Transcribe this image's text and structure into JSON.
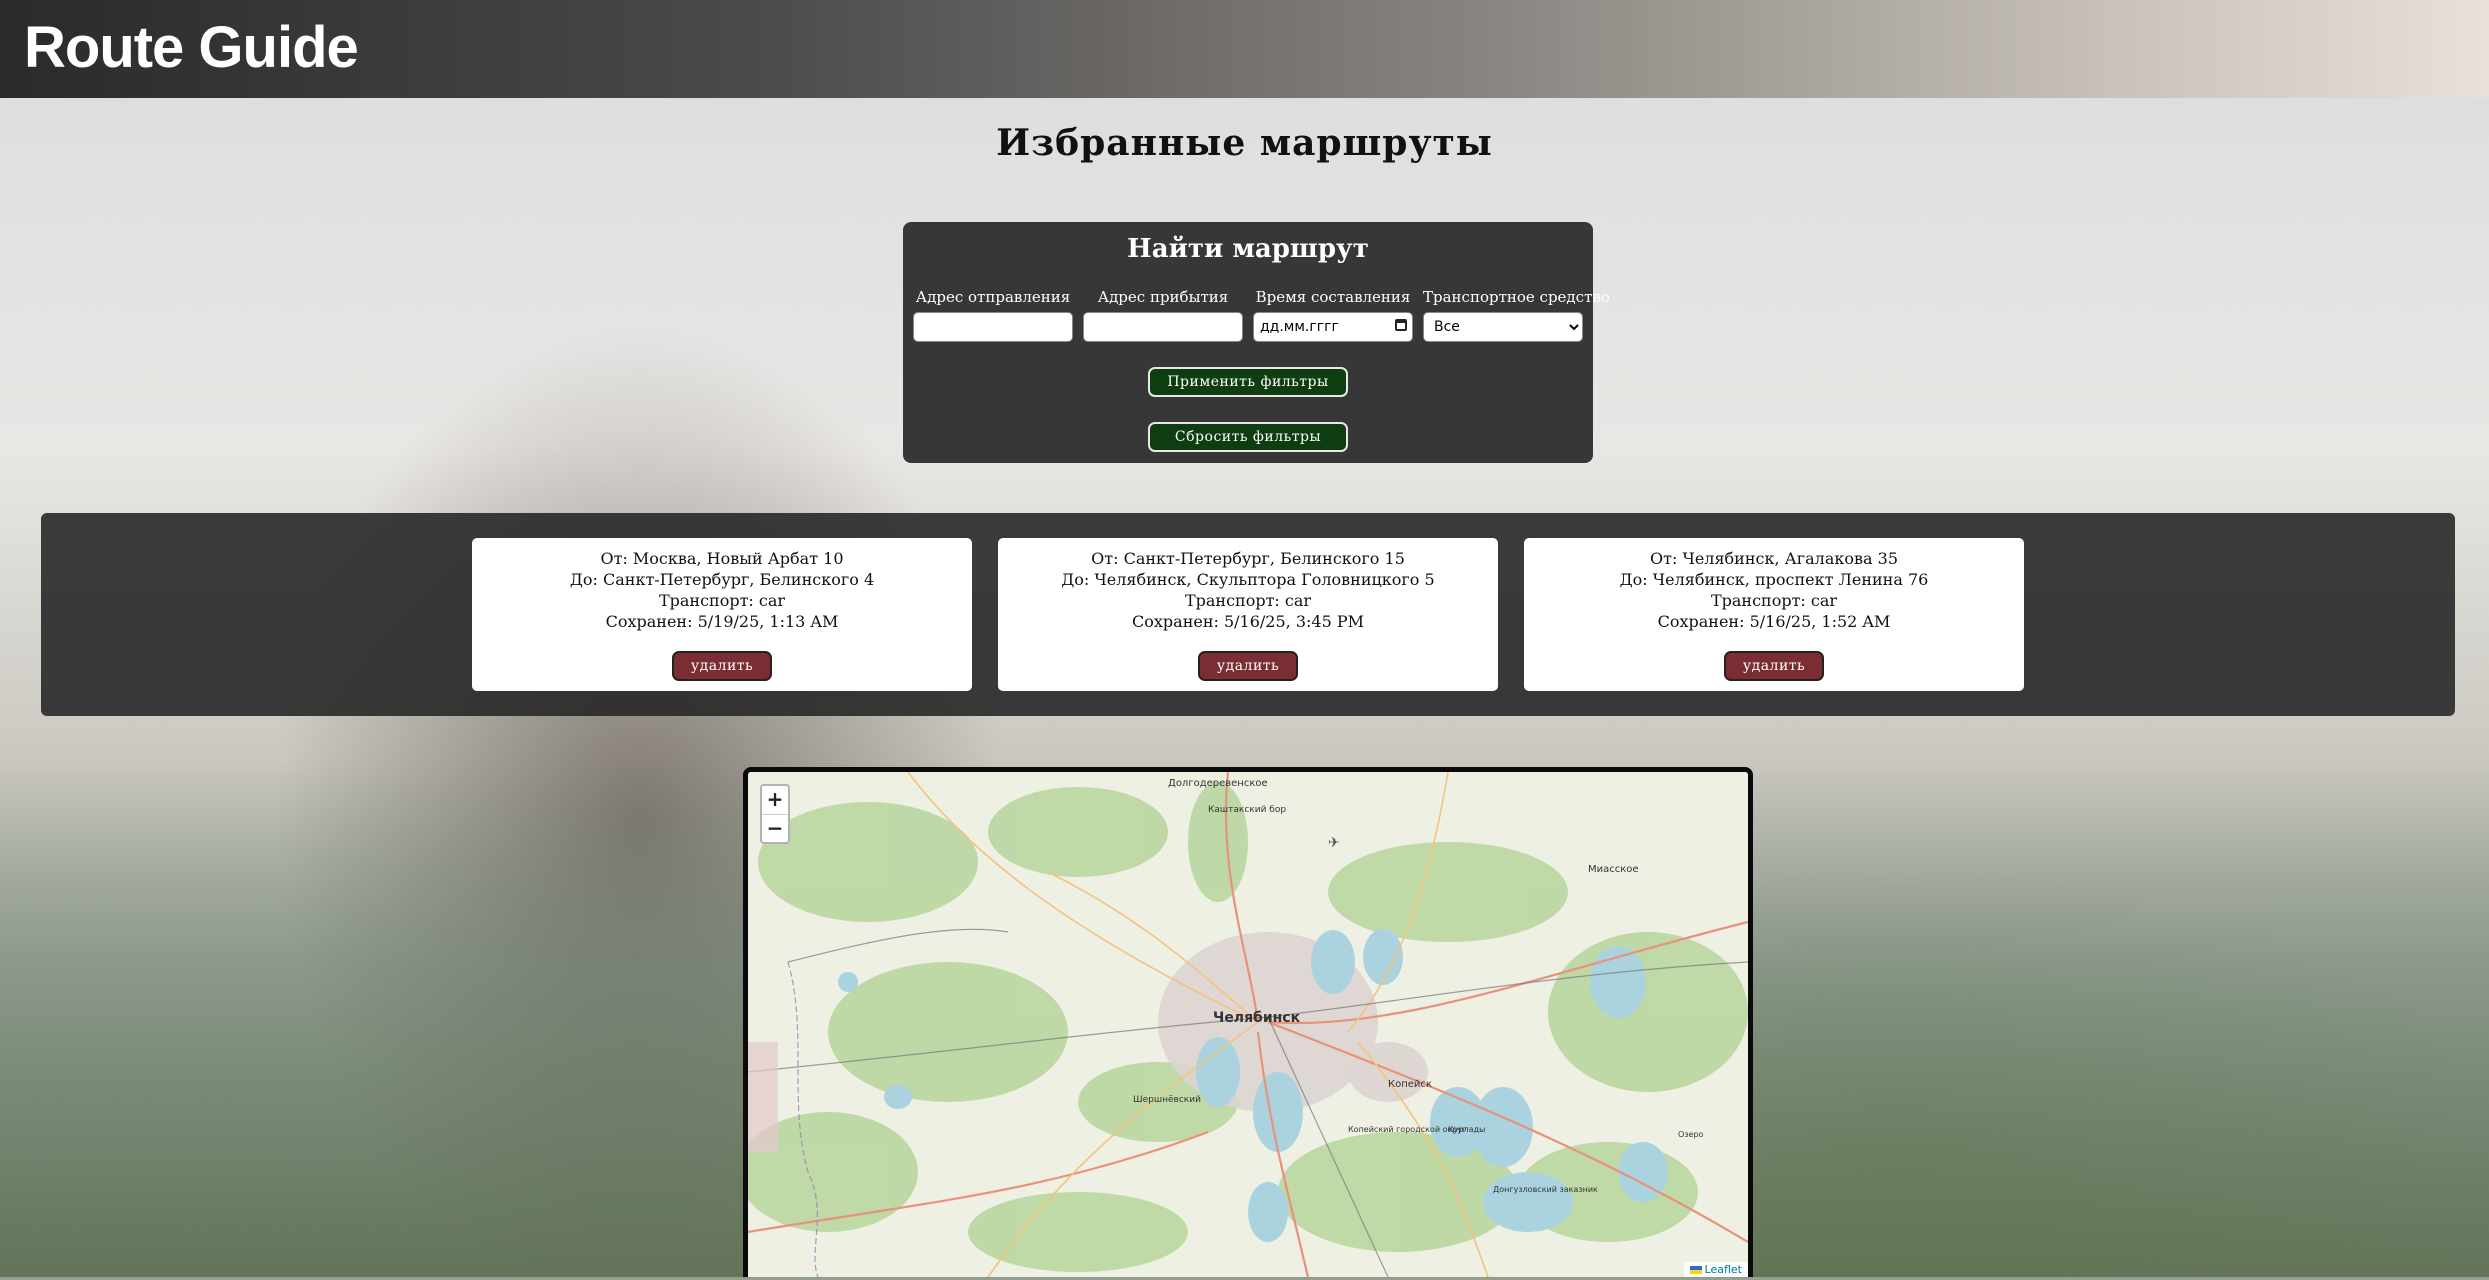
{
  "header": {
    "brand": "Route Guide"
  },
  "page": {
    "title": "Избранные маршруты"
  },
  "filter": {
    "title": "Найти маршрут",
    "fields": {
      "from_label": "Адрес отправления",
      "from_value": "",
      "to_label": "Адрес прибытия",
      "to_value": "",
      "date_label": "Время составления",
      "date_value": "дд.мм.гггг",
      "transport_label": "Транспортное средство",
      "transport_value": "Все"
    },
    "apply_label": "Применить фильтры",
    "reset_label": "Сбросить фильтры"
  },
  "routes": [
    {
      "from": "От: Москва, Новый Арбат 10",
      "to": "До: Санкт-Петербург, Белинского 4",
      "transport": "Транспорт: car",
      "saved": "Сохранен: 5/19/25, 1:13 AM",
      "delete_label": "удалить"
    },
    {
      "from": "От: Санкт-Петербург, Белинского 15",
      "to": "До: Челябинск, Скульптора Головницкого 5",
      "transport": "Транспорт: car",
      "saved": "Сохранен: 5/16/25, 3:45 PM",
      "delete_label": "удалить"
    },
    {
      "from": "От: Челябинск, Агалакова 35",
      "to": "До: Челябинск, проспект Ленина 76",
      "transport": "Транспорт: car",
      "saved": "Сохранен: 5/16/25, 1:52 AM",
      "delete_label": "удалить"
    }
  ],
  "map": {
    "zoom_in": "+",
    "zoom_out": "−",
    "attribution": "Leaflet",
    "labels": {
      "city": "Челябинск",
      "dolgoderevenskoe": "Долгодеревенское",
      "miasskoe": "Миасское",
      "kopeysk": "Копейск",
      "kashtaksky": "Каштакский бор",
      "shershnevsky": "Шершнёвский",
      "kopeysky_okrug": "Копейский городской округ",
      "kurlady": "Курлады",
      "dongzulovsky": "Донгузловский заказник",
      "ozero": "Озеро"
    }
  }
}
